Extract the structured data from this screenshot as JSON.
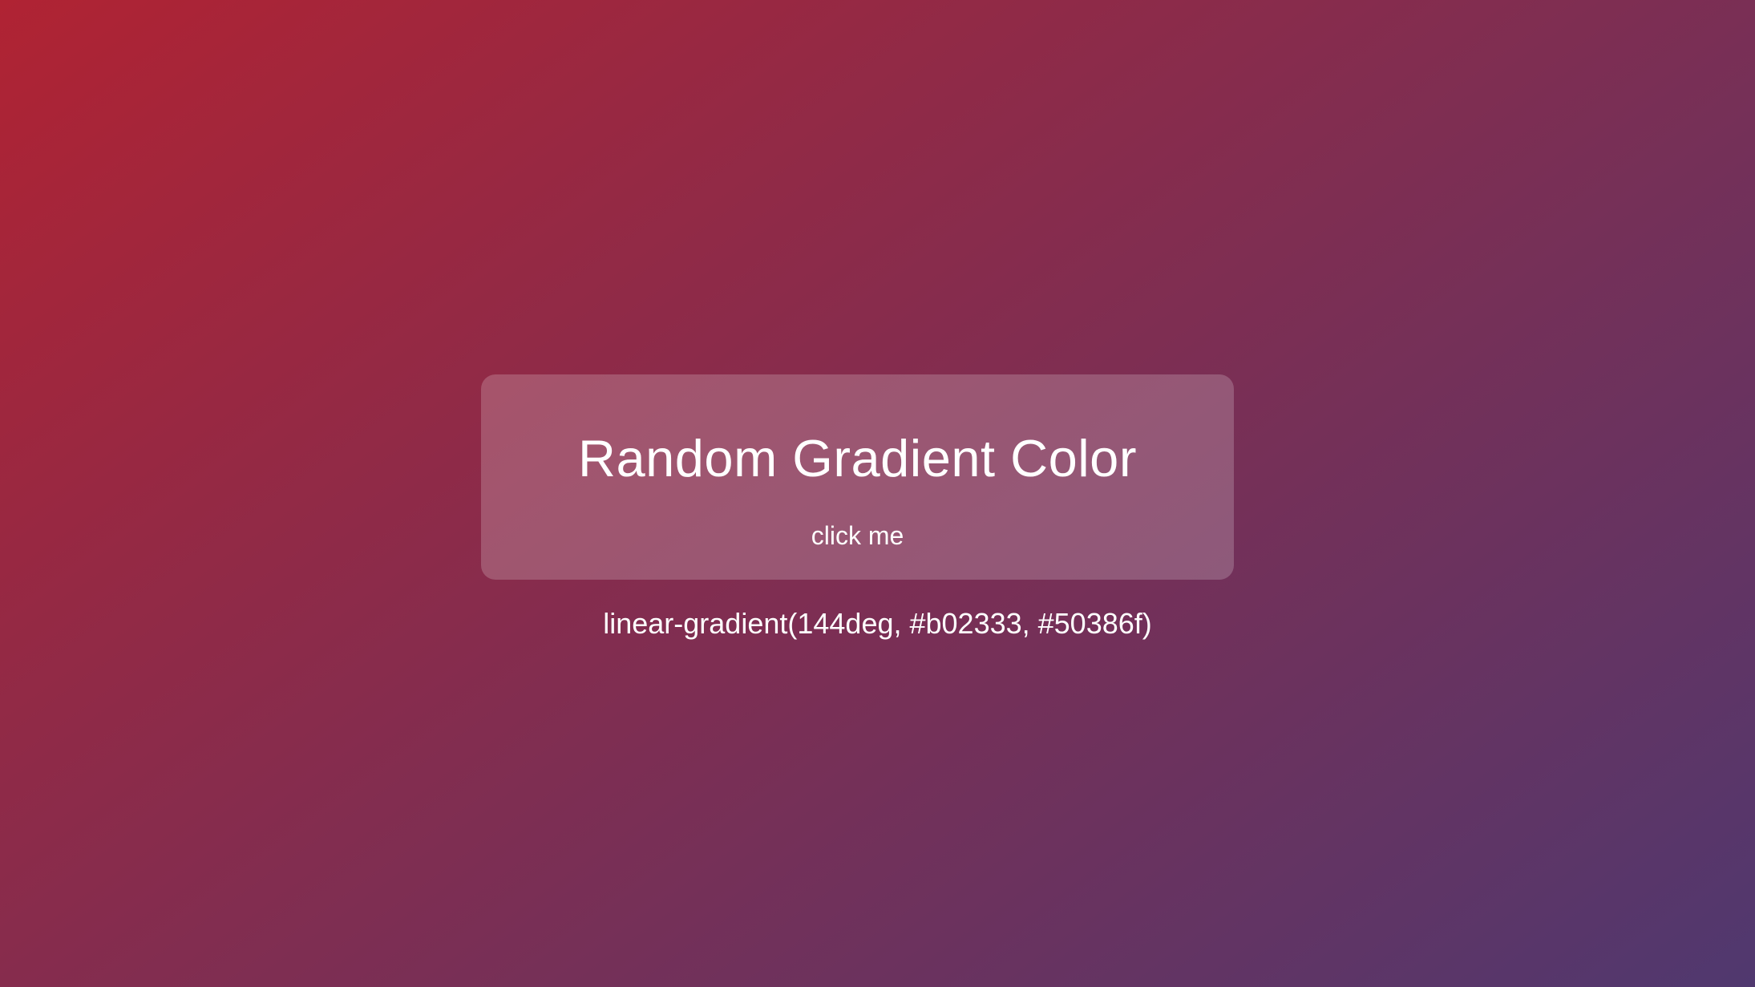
{
  "title": "Random Gradient Color",
  "button_label": "click me",
  "gradient_text": "linear-gradient(144deg, #b02333, #50386f)",
  "gradient": {
    "angle_deg": 144,
    "color_start": "#b02333",
    "color_end": "#50386f"
  },
  "colors": {
    "text": "#ffffff"
  }
}
